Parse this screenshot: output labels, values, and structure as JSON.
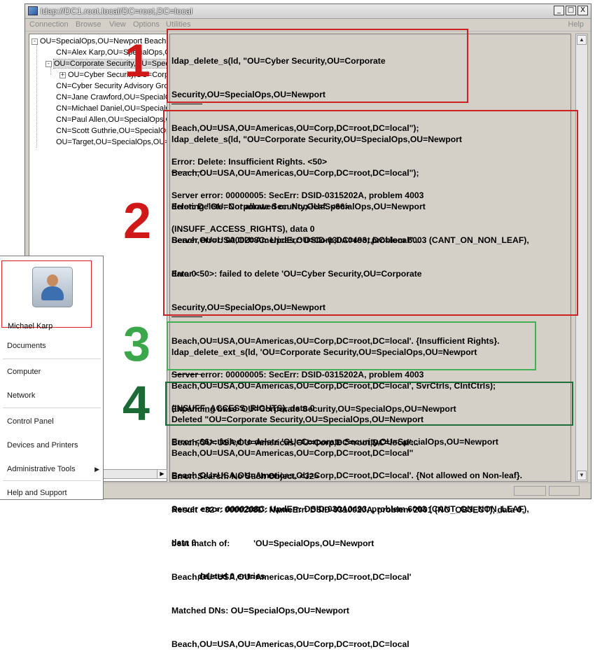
{
  "window": {
    "title": "ldap://DC1.root.local/DC=root,DC=local",
    "controls": {
      "minimize": "_",
      "maximize": "□",
      "close": "X"
    }
  },
  "menu": {
    "items": [
      "Connection",
      "Browse",
      "View",
      "Options",
      "Utilities"
    ],
    "help": "Help"
  },
  "tree": {
    "items": [
      {
        "label": "OU=SpecialOps,OU=Newport Beach,OU=USA",
        "expander": "-"
      },
      {
        "label": "CN=Alex Karp,OU=SpecialOps,OU=Newport"
      },
      {
        "label": "OU=Corporate Security,OU=SpecialOps",
        "expander": "-"
      },
      {
        "label": "OU=Cyber Security,OU=Corporate",
        "expander": "+"
      },
      {
        "label": "CN=Cyber Security Advisory Group"
      },
      {
        "label": "CN=Jane Crawford,OU=SpecialOps"
      },
      {
        "label": "CN=Michael Daniel,OU=SpecialOps"
      },
      {
        "label": "CN=Paul Allen,OU=SpecialOps,OU=N"
      },
      {
        "label": "CN=Scott Guthrie,OU=SpecialOps"
      },
      {
        "label": "OU=Target,OU=SpecialOps,OU=N"
      }
    ]
  },
  "annotations": {
    "numbers": [
      "1",
      "2",
      "3",
      "4"
    ],
    "colors": {
      "box1": "#cc2222",
      "box2": "#cc2222",
      "box3": "#44b055",
      "box4": "#1f6e3a",
      "num1": "#d01818",
      "num2": "#d01818",
      "num3": "#3aa84a",
      "num4": "#1c6a35"
    }
  },
  "output": {
    "block1": [
      "ldap_delete_s(ld, \"OU=Cyber Security,OU=Corporate",
      "Security,OU=SpecialOps,OU=Newport",
      "Beach,OU=USA,OU=Americas,OU=Corp,DC=root,DC=local\");",
      "Error: Delete: Insufficient Rights. <50>",
      "Server error: 00000005: SecErr: DSID-0315202A, problem 4003",
      "(INSUFF_ACCESS_RIGHTS), data 0"
    ],
    "block2a": [
      "ldap_delete_s(ld, \"OU=Corporate Security,OU=SpecialOps,OU=Newport",
      "Beach,OU=USA,OU=Americas,OU=Corp,DC=root,DC=local\");",
      "Error: Delete: Not allowed on Non-leaf. <66>",
      "Server error: 0000208C: UpdErr: DSID-030A0493, problem 6003 (CANT_ON_NON_LEAF),",
      "data 0"
    ],
    "block2b": [
      "deleting \"OU=Corporate Security,OU=SpecialOps,OU=Newport",
      "Beach,OU=USA,OU=Americas,OU=Corp,DC=root,DC=local\"...",
      "Error <50>: failed to delete 'OU=Cyber Security,OU=Corporate",
      "Security,OU=SpecialOps,OU=Newport",
      "Beach,OU=USA,OU=Americas,OU=Corp,DC=root,DC=local'. {Insufficient Rights}.",
      "Server error: 00000005: SecErr: DSID-0315202A, problem 4003",
      "(INSUFF_ACCESS_RIGHTS), data 0",
      "Error <66>: failed to delete 'OU=Corporate Security,OU=SpecialOps,OU=Newport",
      "Beach,OU=USA,OU=Americas,OU=Corp,DC=root,DC=local'. {Not allowed on Non-leaf}.",
      "Server error: 0000208C: UpdErr: DSID-030A0493, problem 6003 (CANT_ON_NON_LEAF),",
      "data 0",
      "           deleted 0 entries"
    ],
    "block3": [
      "ldap_delete_ext_s(ld, 'OU=Corporate Security,OU=SpecialOps,OU=Newport",
      "Beach,OU=USA,OU=Americas,OU=Corp,DC=root,DC=local', SvrCtrls, ClntCtrls);",
      "Deleted \"OU=Corporate Security,OU=SpecialOps,OU=Newport",
      "Beach,OU=USA,OU=Americas,OU=Corp,DC=root,DC=local\""
    ],
    "block4": [
      "Expanding base 'OU=Corporate Security,OU=SpecialOps,OU=Newport",
      "Beach,OU=USA,OU=Americas,OU=Corp,DC=root,DC=local'...",
      "Error: Search: No Such Object. <32>",
      "Result <32>: 0000208D: NameErr: DSID-0310020A, problem 2001 (NO_OBJECT), data 0,",
      "best match of:          'OU=SpecialOps,OU=Newport",
      "Beach,OU=USA,OU=Americas,OU=Corp,DC=root,DC=local'",
      "Matched DNs: OU=SpecialOps,OU=Newport",
      "Beach,OU=USA,OU=Americas,OU=Corp,DC=root,DC=local"
    ]
  },
  "start_menu": {
    "user": "Michael Karp",
    "items": [
      {
        "label": "Documents"
      },
      {
        "label": "Computer"
      },
      {
        "label": "Network"
      },
      {
        "label": "Control Panel"
      },
      {
        "label": "Devices and Printers"
      },
      {
        "label": "Administrative Tools",
        "submenu": "▶"
      },
      {
        "label": "Help and Support"
      }
    ]
  },
  "scroll": {
    "up": "▲",
    "down": "▼",
    "right": "▶"
  }
}
